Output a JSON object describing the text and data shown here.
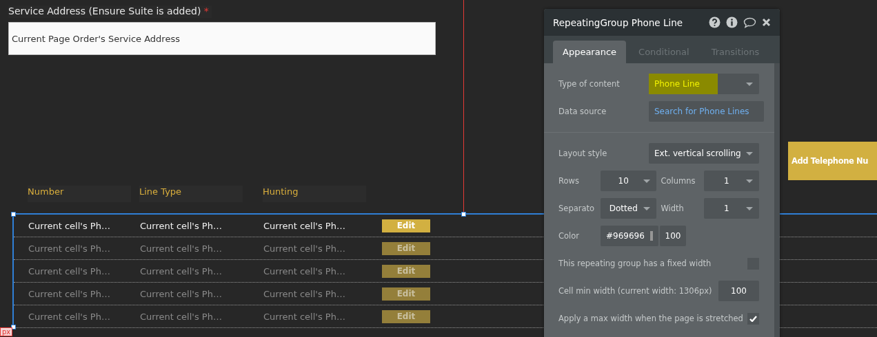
{
  "canvas": {
    "address_label": "Service Address (Ensure Suite is added)",
    "required_mark": "*",
    "address_input": {
      "value": "Current Page Order's Service Address"
    },
    "add_button": "Add Telephone Nu",
    "ruler_label": "px",
    "table": {
      "columns": [
        "Number",
        "Line Type",
        "Hunting"
      ],
      "rows": [
        {
          "cells": [
            "Current cell's Ph…",
            "Current cell's Ph…",
            "Current cell's Ph…"
          ],
          "action": "Edit",
          "dimmed": false
        },
        {
          "cells": [
            "Current cell's Ph…",
            "Current cell's Ph…",
            "Current cell's Ph…"
          ],
          "action": "Edit",
          "dimmed": true
        },
        {
          "cells": [
            "Current cell's Ph…",
            "Current cell's Ph…",
            "Current cell's Ph…"
          ],
          "action": "Edit",
          "dimmed": true
        },
        {
          "cells": [
            "Current cell's Ph…",
            "Current cell's Ph…",
            "Current cell's Ph…"
          ],
          "action": "Edit",
          "dimmed": true
        },
        {
          "cells": [
            "Current cell's Ph…",
            "Current cell's Ph…",
            "Current cell's Ph…"
          ],
          "action": "Edit",
          "dimmed": true
        }
      ]
    }
  },
  "panel": {
    "title": "RepeatingGroup Phone Line",
    "tabs": [
      {
        "label": "Appearance",
        "selected": true
      },
      {
        "label": "Conditional",
        "selected": false
      },
      {
        "label": "Transitions",
        "selected": false
      }
    ],
    "sections": [
      [
        {
          "kind": "select",
          "label": "Type of content",
          "value": "Phone Line",
          "highlighted": true
        },
        {
          "kind": "link",
          "label": "Data source",
          "value": "Search for Phone Lines"
        }
      ],
      [
        {
          "kind": "select",
          "label": "Layout style",
          "value": "Ext. vertical scrolling",
          "highlighted": false
        },
        {
          "kind": "pair",
          "items": [
            {
              "label": "Rows",
              "value": "10"
            },
            {
              "label": "Columns",
              "value": "1"
            }
          ]
        },
        {
          "kind": "pair",
          "items": [
            {
              "label": "Separato",
              "value": "Dotted"
            },
            {
              "label": "Width",
              "value": "1"
            }
          ]
        },
        {
          "kind": "color",
          "label": "Color",
          "value": "#969696",
          "color": "#969696",
          "opacity": "100"
        },
        {
          "kind": "checkbox",
          "label": "This repeating group has a fixed width",
          "checked": false
        },
        {
          "kind": "number",
          "label": "Cell min width (current width: 1306px)",
          "value": "100"
        },
        {
          "kind": "checkbox",
          "label": "Apply a max width when the page is stretched",
          "checked": true
        }
      ]
    ]
  }
}
